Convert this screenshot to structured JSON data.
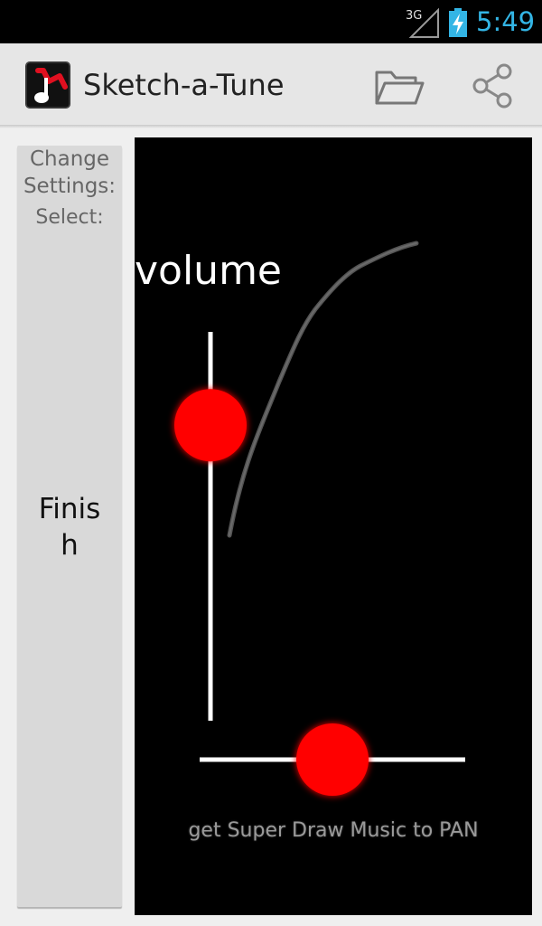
{
  "status_bar": {
    "network_label": "3G",
    "time": "5:49",
    "icons": [
      "signal-icon",
      "battery-charging-icon"
    ]
  },
  "action_bar": {
    "app_title": "Sketch-a-Tune",
    "icons": [
      "app-logo-icon",
      "folder-open-icon",
      "share-icon"
    ]
  },
  "settings": {
    "change_label": "Change Settings:",
    "select_label": "Select:",
    "finish_label": "Finish"
  },
  "canvas": {
    "parameter_label": "volume",
    "pan_message": "get Super Draw Music to PAN",
    "vertical_slider_level": 0.76,
    "horizontal_slider_level": 0.5,
    "accent_color": "#ff0000"
  }
}
